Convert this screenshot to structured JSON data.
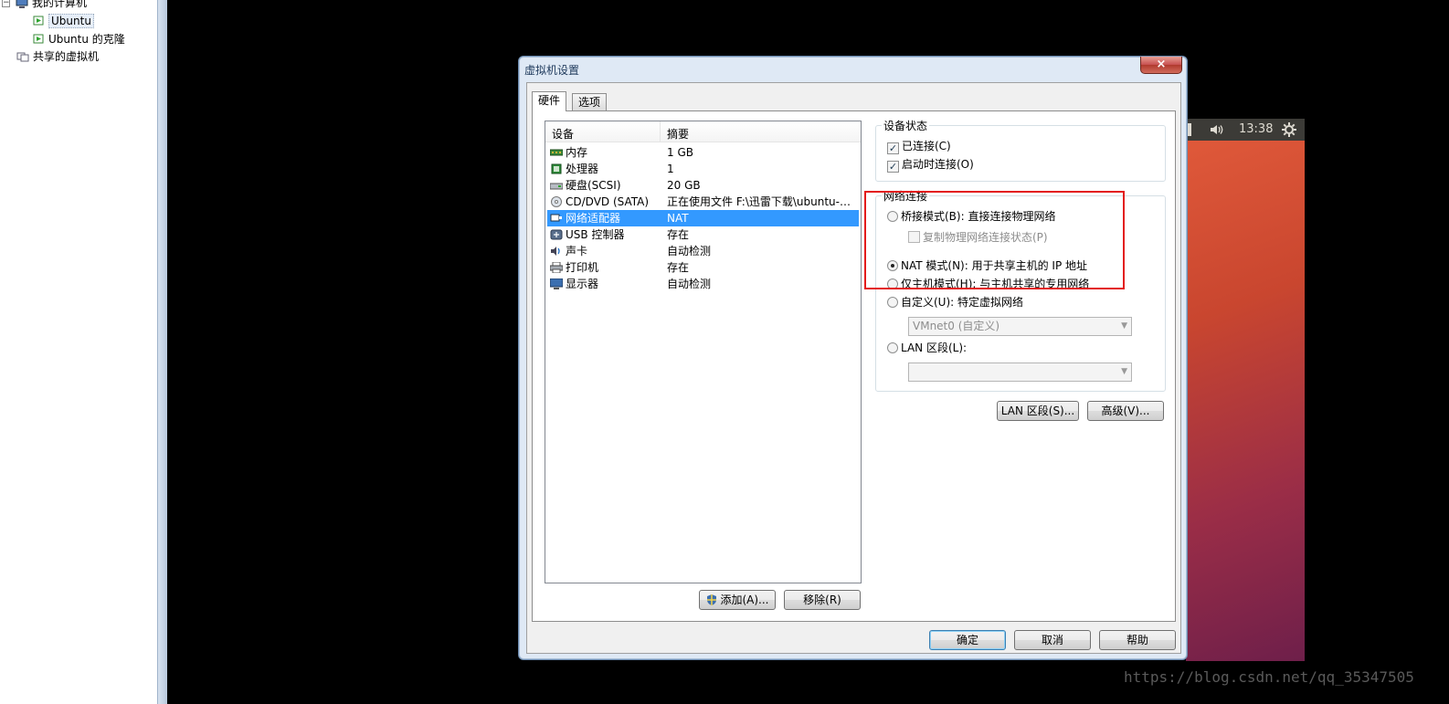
{
  "library": {
    "items": [
      {
        "label": "我的计算机"
      },
      {
        "label": "Ubuntu"
      },
      {
        "label": "Ubuntu 的克隆"
      },
      {
        "label": "共享的虚拟机"
      }
    ]
  },
  "vm_topbar": {
    "volume_icon": "speaker-icon",
    "time": "13:38",
    "settings_icon": "gear-icon"
  },
  "dialog": {
    "title": "虚拟机设置",
    "close": "×",
    "tabs": [
      "硬件",
      "选项"
    ],
    "device_list": {
      "headers": [
        "设备",
        "摘要"
      ],
      "rows": [
        {
          "name": "内存",
          "summary": "1 GB",
          "icon": "memory-icon"
        },
        {
          "name": "处理器",
          "summary": "1",
          "icon": "cpu-icon"
        },
        {
          "name": "硬盘(SCSI)",
          "summary": "20 GB",
          "icon": "harddisk-icon"
        },
        {
          "name": "CD/DVD (SATA)",
          "summary": "正在使用文件 F:\\迅雷下载\\ubuntu-1...",
          "icon": "cdrom-icon"
        },
        {
          "name": "网络适配器",
          "summary": "NAT",
          "icon": "network-adapter-icon",
          "selected": true
        },
        {
          "name": "USB 控制器",
          "summary": "存在",
          "icon": "usb-icon"
        },
        {
          "name": "声卡",
          "summary": "自动检测",
          "icon": "sound-icon"
        },
        {
          "name": "打印机",
          "summary": "存在",
          "icon": "printer-icon"
        },
        {
          "name": "显示器",
          "summary": "自动检测",
          "icon": "monitor-icon"
        }
      ],
      "add_button": "添加(A)...",
      "remove_button": "移除(R)"
    },
    "device_status": {
      "title": "设备状态",
      "connected": "已连接(C)",
      "connect_on_start": "启动时连接(O)"
    },
    "network": {
      "title": "网络连接",
      "bridged": "桥接模式(B): 直接连接物理网络",
      "replicate": "复制物理网络连接状态(P)",
      "nat": "NAT 模式(N): 用于共享主机的 IP 地址",
      "host_only": "仅主机模式(H): 与主机共享的专用网络",
      "custom": "自定义(U): 特定虚拟网络",
      "custom_value": "VMnet0 (自定义)",
      "lan": "LAN 区段(L):",
      "lan_value": "",
      "lan_segments_button": "LAN 区段(S)...",
      "advanced_button": "高级(V)..."
    },
    "footer": {
      "ok": "确定",
      "cancel": "取消",
      "help": "帮助"
    }
  },
  "watermark": "https://blog.csdn.net/qq_35347505",
  "colors": {
    "selection": "#3399ff",
    "highlight_box": "#e31b1b"
  }
}
